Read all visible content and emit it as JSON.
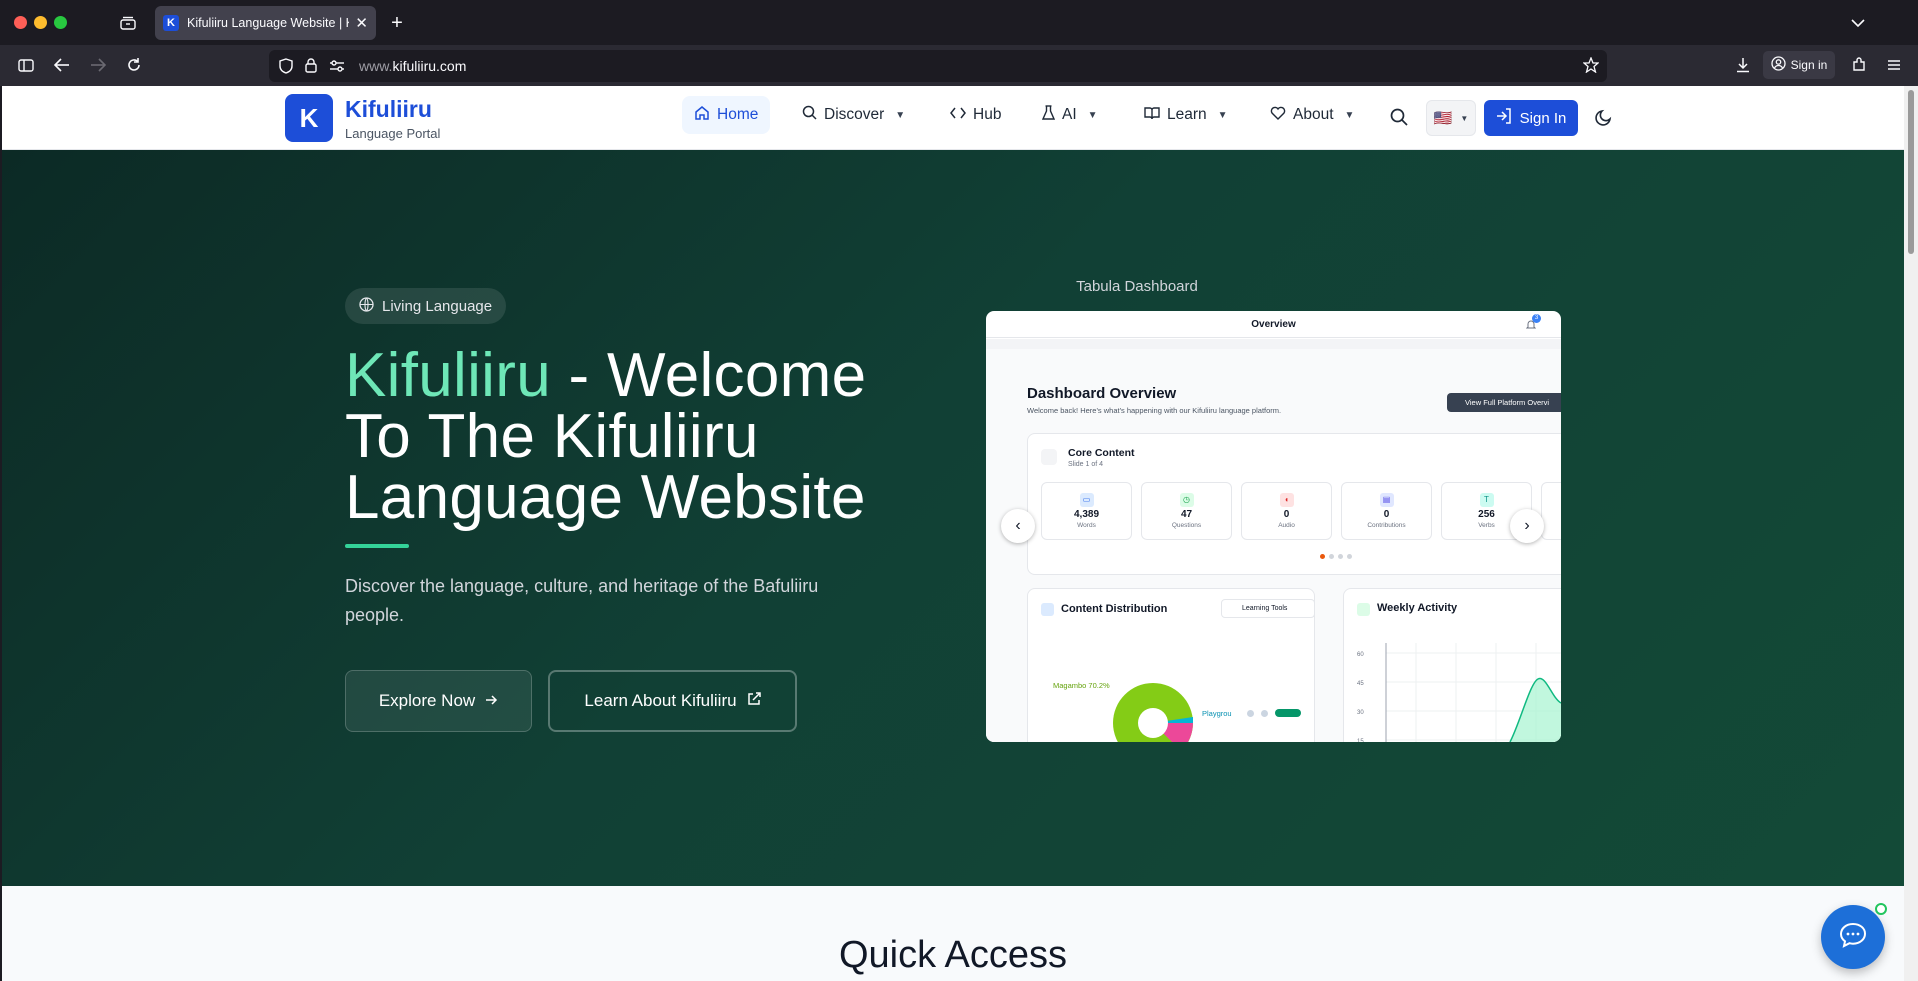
{
  "browser": {
    "tab_title": "Kifuliiru Language Website | Kifu",
    "tab_favicon": "K",
    "url_prefix": "www.",
    "url_domain": "kifuliiru.com",
    "signin_label": "Sign in"
  },
  "header": {
    "logo_letter": "K",
    "brand": "Kifuliiru",
    "brand_sub": "Language Portal",
    "nav": [
      {
        "label": "Home",
        "icon": "home-icon"
      },
      {
        "label": "Discover",
        "icon": "search-icon"
      },
      {
        "label": "Hub",
        "icon": "code-icon"
      },
      {
        "label": "AI",
        "icon": "flask-icon"
      },
      {
        "label": "Learn",
        "icon": "book-icon"
      },
      {
        "label": "About",
        "icon": "heart-icon"
      }
    ],
    "signin_label": "Sign In",
    "language_flag": "🇺🇸"
  },
  "hero": {
    "badge": "Living Language",
    "headline_accent": "Kifuliiru",
    "headline_rest": " - Welcome To The Kifuliiru Language Website",
    "description": "Discover the language, culture, and heritage of the Bafuliiru people.",
    "explore_label": "Explore Now",
    "learn_label": "Learn About Kifuliiru",
    "accent_color": "#6ee7b7"
  },
  "dashboard": {
    "caption": "Tabula Dashboard",
    "top_title": "Overview",
    "notif_count": "3",
    "title": "Dashboard Overview",
    "subtitle": "Welcome back! Here's what's happening with our Kifuliiru language platform.",
    "view_full_label": "View Full Platform Overvi",
    "core_title": "Core Content",
    "core_slide": "Slide 1 of 4",
    "stats": [
      {
        "value": "4,389",
        "label": "Words"
      },
      {
        "value": "47",
        "label": "Questions"
      },
      {
        "value": "0",
        "label": "Audio"
      },
      {
        "value": "0",
        "label": "Contributions"
      },
      {
        "value": "256",
        "label": "Verbs"
      }
    ],
    "distribution_title": "Content Distribution",
    "distribution_select": "Learning Tools",
    "pie_label_1": "Magambo 70.2%",
    "pie_label_2": "Playgrou",
    "weekly_title": "Weekly Activity",
    "weekly_ticks": [
      "60",
      "45",
      "30",
      "15"
    ]
  },
  "quick_access": {
    "title": "Quick Access"
  }
}
